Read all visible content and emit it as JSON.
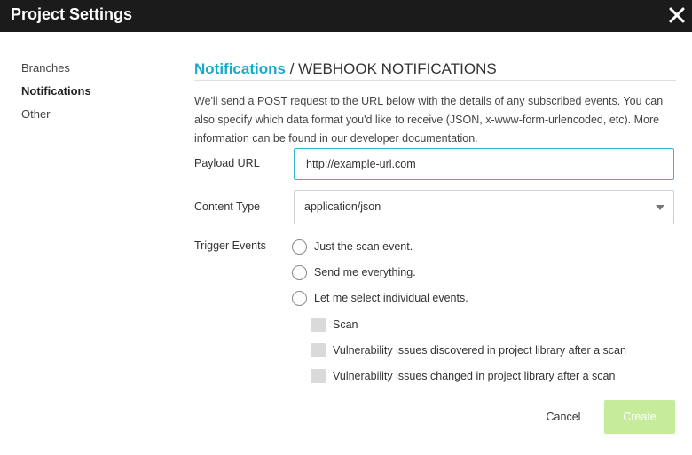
{
  "window": {
    "title": "Project Settings",
    "close_icon": "close-icon"
  },
  "sidebar": {
    "items": [
      {
        "label": "Branches"
      },
      {
        "label": "Notifications",
        "active": true
      },
      {
        "label": "Other"
      }
    ]
  },
  "main": {
    "heading_section": "Notifications",
    "heading_separator": "/",
    "heading_subsection": "WEBHOOK NOTIFICATIONS",
    "description": "We'll send a POST request to the URL below with the details of any subscribed events. You can also specify which data format you'd like to receive (JSON, x-www-form-urlencoded, etc). More information can be found in our developer documentation.",
    "payload_url": {
      "label": "Payload URL",
      "value": "http://example-url.com"
    },
    "content_type": {
      "label": "Content Type",
      "value": "application/json"
    },
    "trigger_events": {
      "label": "Trigger Events",
      "options": [
        {
          "label": "Just the scan event."
        },
        {
          "label": "Send me everything."
        },
        {
          "label": "Let me select individual events."
        }
      ],
      "events": [
        {
          "label": "Scan"
        },
        {
          "label": "Vulnerability issues discovered in project library after a scan"
        },
        {
          "label": "Vulnerability issues changed in project library after a scan"
        }
      ]
    }
  },
  "footer": {
    "cancel_label": "Cancel",
    "create_label": "Create"
  },
  "colors": {
    "accent": "#1ea7c8",
    "create_button": "#c6eb9a",
    "titlebar": "#1b1b1b"
  }
}
